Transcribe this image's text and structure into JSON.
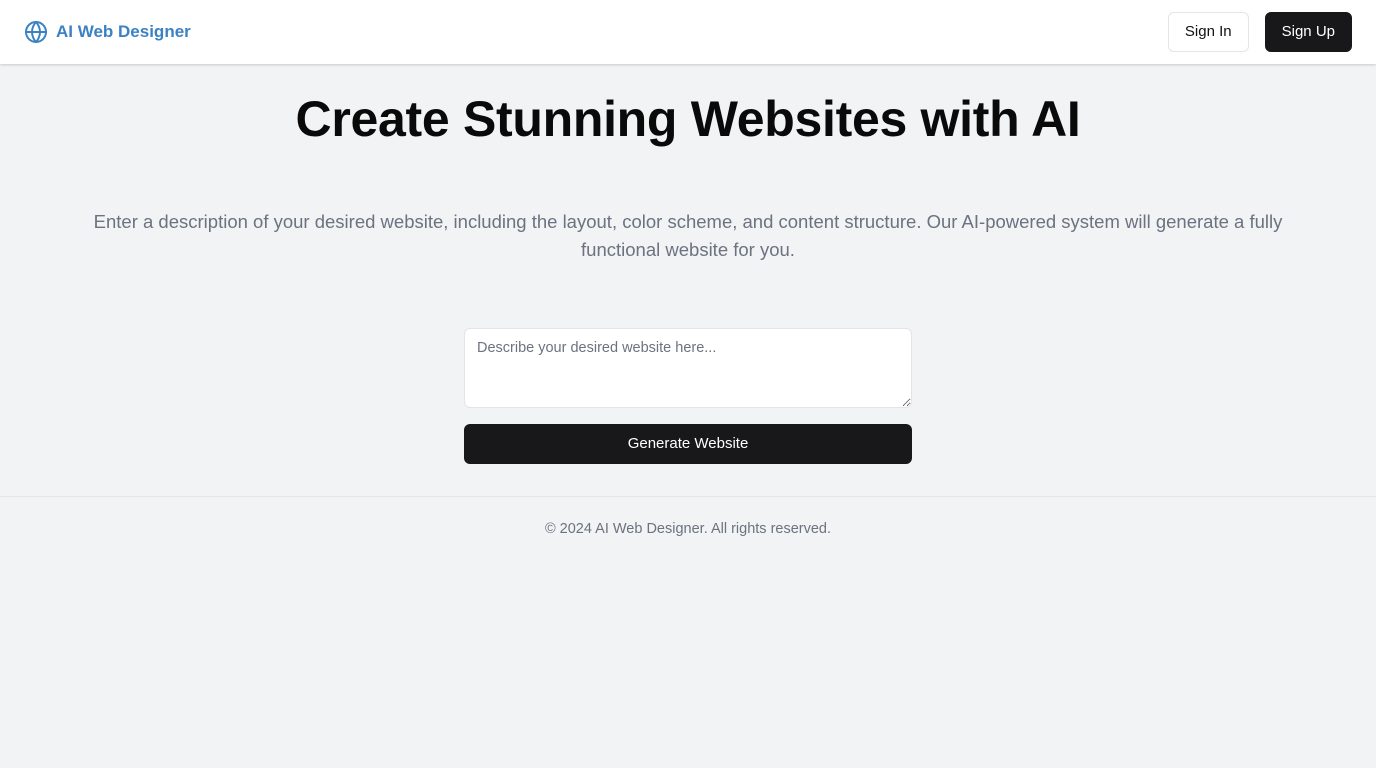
{
  "header": {
    "brand": {
      "icon": "globe-icon",
      "label": "AI Web Designer",
      "color": "#3b82c4"
    },
    "sign_in_label": "Sign In",
    "sign_up_label": "Sign Up"
  },
  "hero": {
    "title": "Create Stunning Websites with AI",
    "description": "Enter a description of your desired website, including the layout, color scheme, and content structure. Our AI-powered system will generate a fully functional website for you."
  },
  "form": {
    "prompt_value": "",
    "prompt_placeholder": "Describe your desired website here...",
    "generate_label": "Generate Website"
  },
  "footer": {
    "text": "© 2024 AI Web Designer. All rights reserved."
  },
  "colors": {
    "background": "#f2f3f5",
    "header_background": "#ffffff",
    "dark_button": "#18181b",
    "muted_text": "#6b7280",
    "brand_accent": "#3b82c4"
  }
}
